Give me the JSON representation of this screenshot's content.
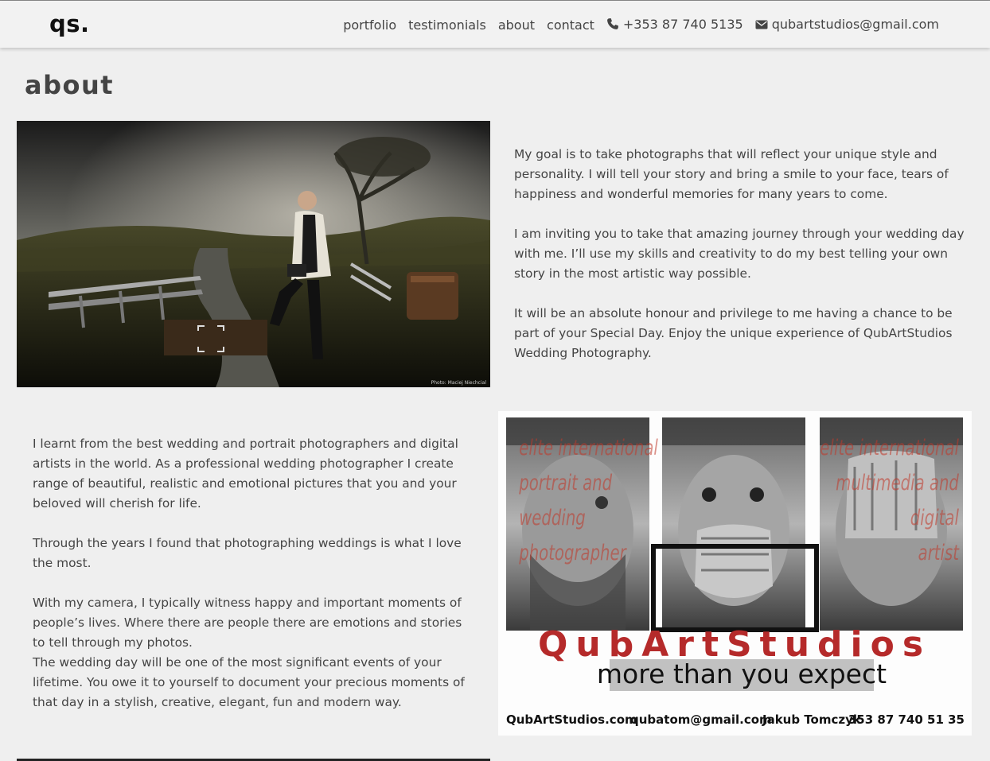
{
  "header": {
    "logo": "qs.",
    "nav": [
      "portfolio",
      "testimonials",
      "about",
      "contact"
    ],
    "phone": "+353 87 740 5135",
    "email": "qubartstudios@gmail.com",
    "phone_icon": "phone-icon",
    "email_icon": "envelope-icon"
  },
  "page": {
    "title": "about"
  },
  "photo1": {
    "caption": "Photo: Maciej Niechcial"
  },
  "section1": {
    "paragraphs": [
      "My goal is to take photographs that will reflect your unique style and personality. I will tell your story and bring a smile to your face, tears of happiness and wonderful memories for many years to come.",
      "I am inviting you to take that amazing journey through your wedding day with me. I’ll use my skills and creativity to do my best telling your own story in the most artistic way possible.",
      "It will be an absolute honour and privilege to me having a chance to be part of your Special Day. Enjoy the unique experience of QubArtStudios Wedding Photography."
    ]
  },
  "section2": {
    "paragraphs": [
      "I learnt from the best wedding and portrait photographers and digital artists in the world. As a professional wedding photographer I create range of beautiful, realistic and emotional pictures that you and your beloved will cherish for life.",
      "Through the years I found that photographing weddings is what I love the most.",
      "With my camera, I typically witness happy and important moments of people’s lives. Where there are people there are emotions and stories to tell through my photos.",
      "The wedding day will be one of the most significant events of your lifetime. You owe it to yourself to document your precious moments of that day in a stylish, creative, elegant, fun and modern way."
    ]
  },
  "poster": {
    "left_text": [
      "elite international",
      "portrait and",
      "wedding",
      "photographer"
    ],
    "right_text": [
      "elite international",
      "multimedia and",
      "digital",
      "artist"
    ],
    "brand": "QubArtStudios",
    "tagline": "more than you expect",
    "footer": [
      "QubArtStudios.com",
      "qubatom@gmail.com",
      "Jakub Tomczyk",
      "353 87 740 51 35"
    ]
  }
}
